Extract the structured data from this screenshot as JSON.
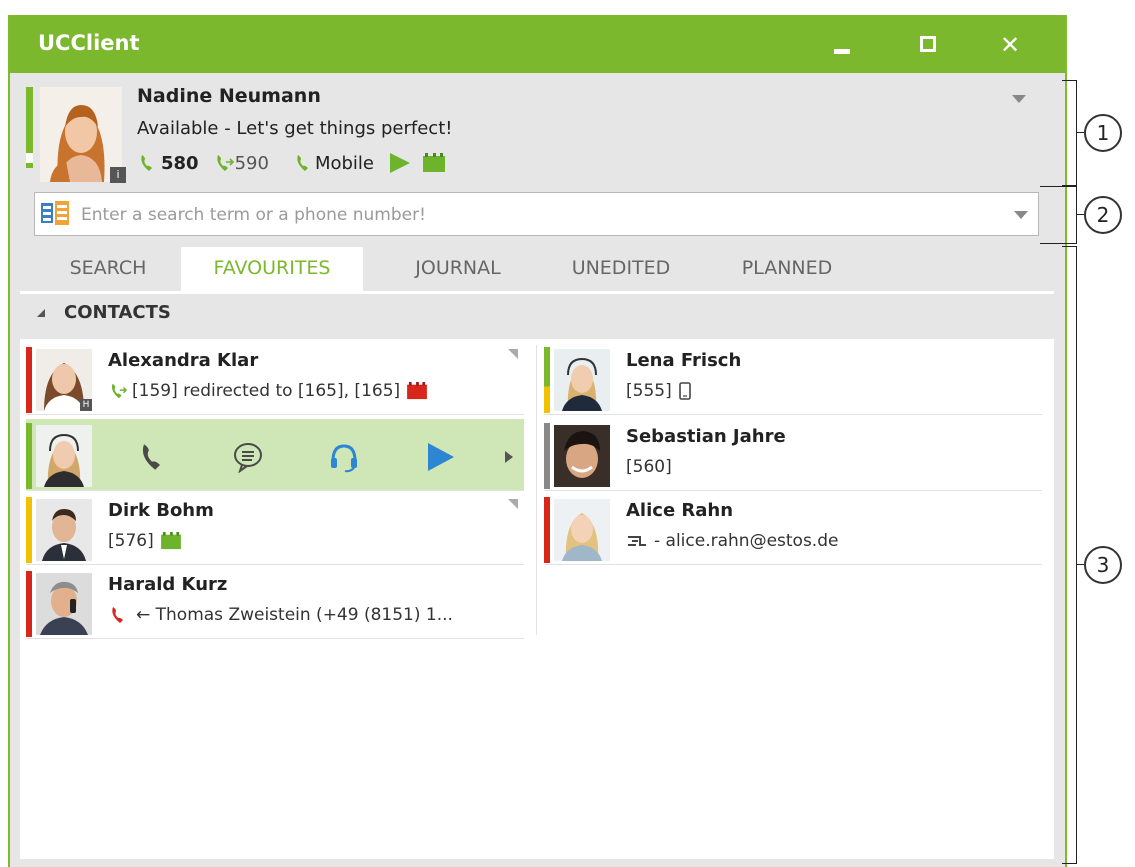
{
  "window": {
    "title": "UCClient"
  },
  "profile": {
    "name": "Nadine Neumann",
    "status": "Available - Let's get things perfect!",
    "line1": "580",
    "line2": "590",
    "line3": "Mobile",
    "info_badge": "i"
  },
  "search": {
    "placeholder": "Enter a search term or a phone number!"
  },
  "tabs": [
    {
      "label": "SEARCH"
    },
    {
      "label": "FAVOURITES"
    },
    {
      "label": "JOURNAL"
    },
    {
      "label": "UNEDITED"
    },
    {
      "label": "PLANNED"
    }
  ],
  "group": {
    "label": "CONTACTS"
  },
  "contacts": {
    "alexandra": {
      "name": "Alexandra Klar",
      "detail": "[159] redirected to [165], [165]"
    },
    "lena": {
      "name": "Lena Frisch",
      "detail": "[555]"
    },
    "sebastian": {
      "name": "Sebastian Jahre",
      "detail": "[560]"
    },
    "dirk": {
      "name": "Dirk Bohm",
      "detail": "[576]"
    },
    "alice": {
      "name": "Alice Rahn",
      "detail": "- alice.rahn@estos.de"
    },
    "harald": {
      "name": "Harald Kurz",
      "detail": "← Thomas Zweistein (+49 (8151) 1..."
    }
  },
  "callouts": [
    "1",
    "2",
    "3"
  ],
  "colors": {
    "accent": "#7cb82e",
    "busy": "#d9261c",
    "away": "#f2c200"
  }
}
